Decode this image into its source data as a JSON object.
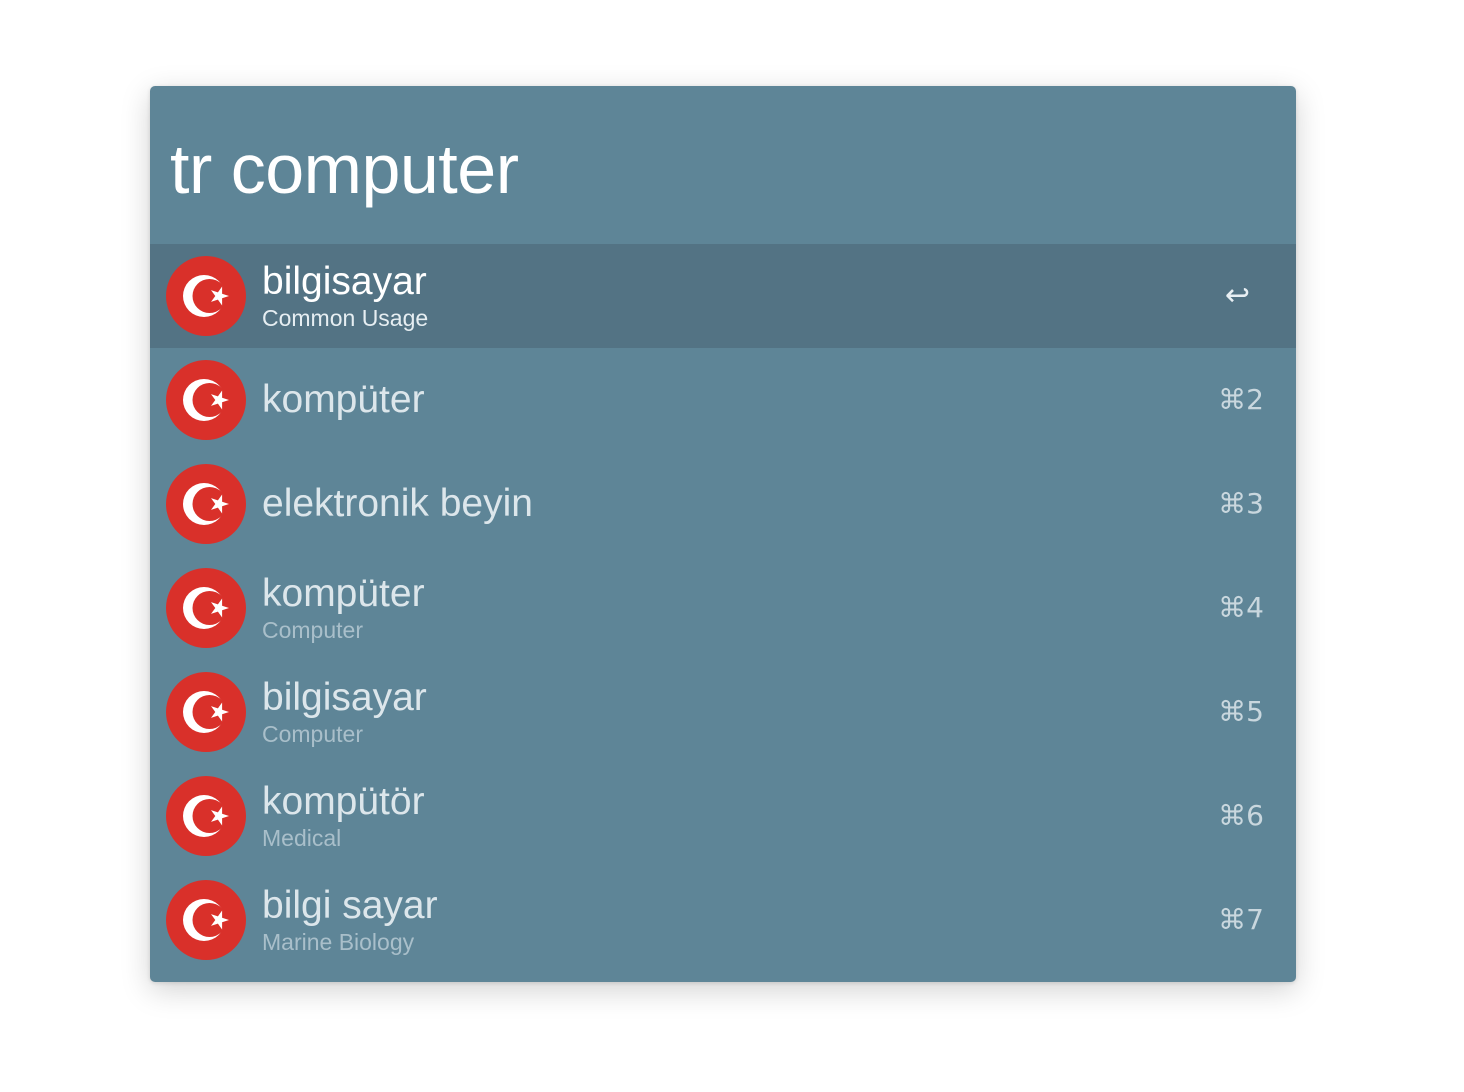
{
  "search": {
    "query": "tr computer"
  },
  "flag_colors": {
    "red": "#d9302a",
    "white": "#ffffff"
  },
  "results": [
    {
      "title": "bilgisayar",
      "subtitle": "Common Usage",
      "shortcut": "↩",
      "selected": true
    },
    {
      "title": "kompüter",
      "subtitle": "",
      "shortcut": "⌘2",
      "selected": false
    },
    {
      "title": "elektronik beyin",
      "subtitle": "",
      "shortcut": "⌘3",
      "selected": false
    },
    {
      "title": "kompüter",
      "subtitle": "Computer",
      "shortcut": "⌘4",
      "selected": false
    },
    {
      "title": "bilgisayar",
      "subtitle": "Computer",
      "shortcut": "⌘5",
      "selected": false
    },
    {
      "title": "kompütör",
      "subtitle": "Medical",
      "shortcut": "⌘6",
      "selected": false
    },
    {
      "title": "bilgi sayar",
      "subtitle": "Marine Biology",
      "shortcut": "⌘7",
      "selected": false
    }
  ]
}
